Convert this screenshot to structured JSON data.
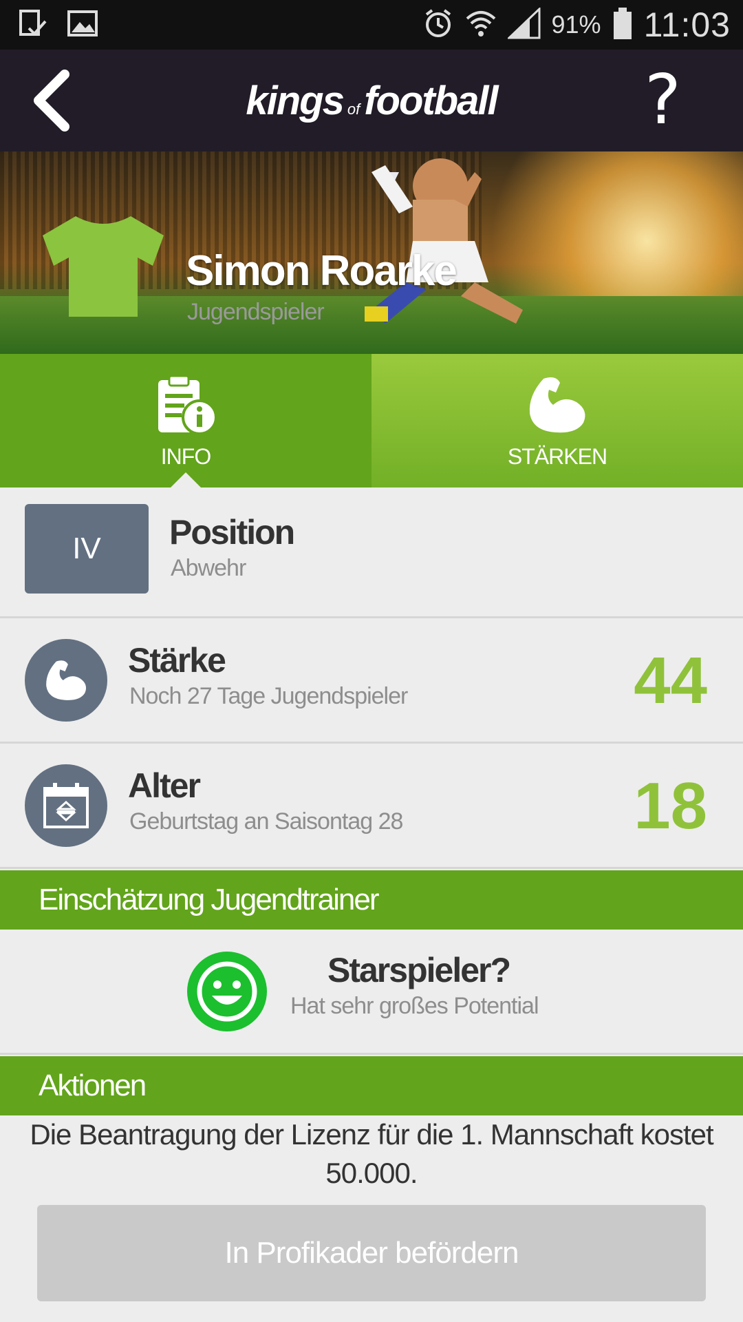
{
  "status_bar": {
    "battery_percent": "91%",
    "time": "11:03",
    "icons": [
      "download-complete-icon",
      "image-icon",
      "alarm-icon",
      "wifi-icon",
      "signal-icon",
      "battery-icon"
    ]
  },
  "nav": {
    "logo_main_left": "kings",
    "logo_of": "of",
    "logo_main_right": "football",
    "help_label": "?"
  },
  "player": {
    "name": "Simon Roarke",
    "role": "Jugendspieler",
    "jersey_color": "#8bc43f"
  },
  "tabs": [
    {
      "label": "INFO",
      "icon": "info-document-icon",
      "active": true
    },
    {
      "label": "STÄRKEN",
      "icon": "flexed-bicep-icon",
      "active": false
    }
  ],
  "position": {
    "badge": "IV",
    "title": "Position",
    "subtitle": "Abwehr"
  },
  "strength": {
    "title": "Stärke",
    "subtitle": "Noch 27 Tage Jugendspieler",
    "value": "44"
  },
  "age": {
    "title": "Alter",
    "subtitle": "Geburtstag an Saisontag 28",
    "value": "18"
  },
  "assessment": {
    "header": "Einschätzung Jugendtrainer",
    "title": "Starspieler?",
    "subtitle": "Hat sehr großes Potential"
  },
  "actions": {
    "header": "Aktionen",
    "description_line1": "Die Beantragung der Lizenz für die 1. Mannschaft kostet",
    "description_line2": "50.000.",
    "button_label": "In Profikader befördern"
  },
  "colors": {
    "accent_green": "#62a41b",
    "value_green": "#8fc23a",
    "nav_bg": "#211c27",
    "slate": "#637081",
    "smiley_green": "#1cbf2e"
  }
}
